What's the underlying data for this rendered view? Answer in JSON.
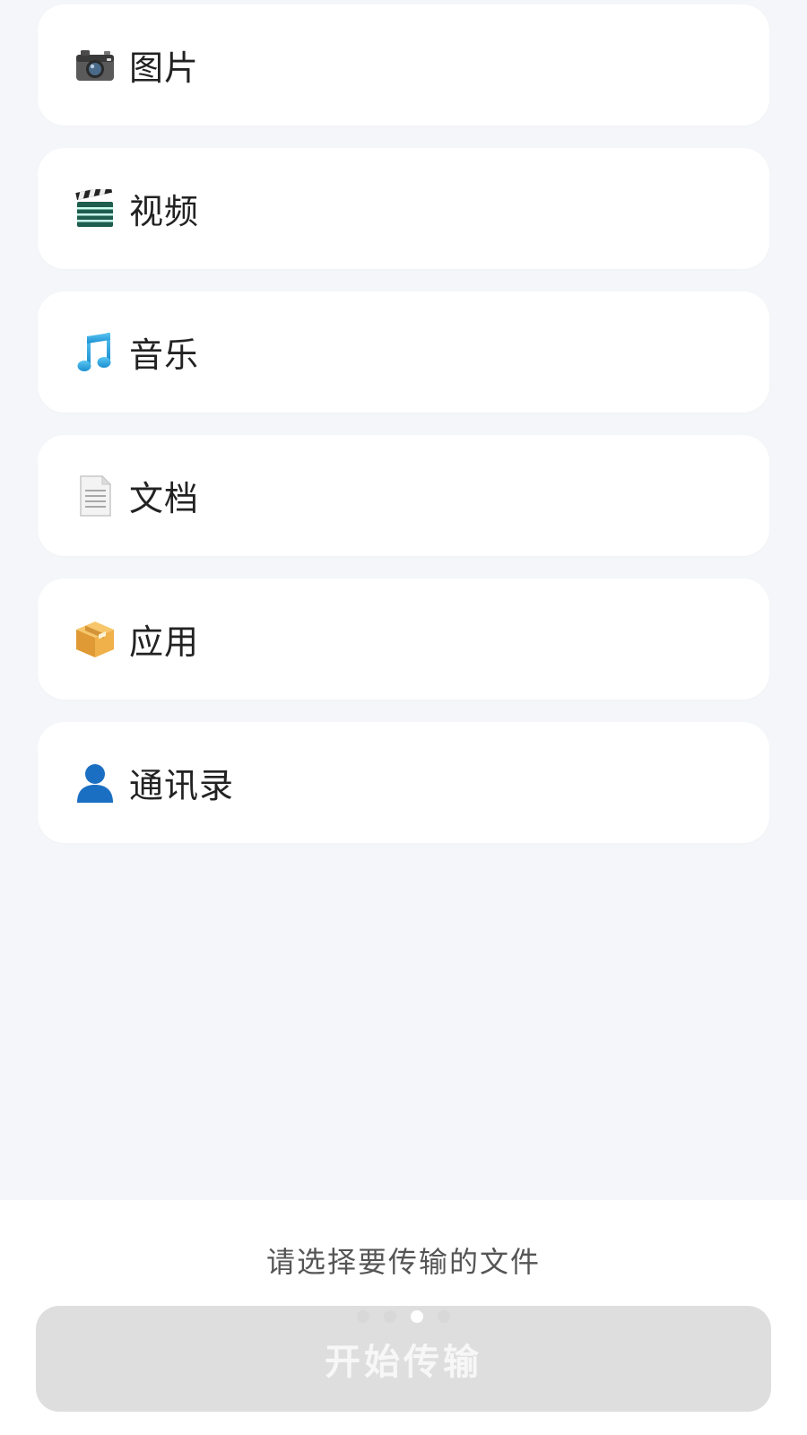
{
  "categories": [
    {
      "label": "图片",
      "icon": "camera-icon"
    },
    {
      "label": "视频",
      "icon": "clapperboard-icon"
    },
    {
      "label": "音乐",
      "icon": "music-note-icon"
    },
    {
      "label": "文档",
      "icon": "document-icon"
    },
    {
      "label": "应用",
      "icon": "package-icon"
    },
    {
      "label": "通讯录",
      "icon": "contact-icon"
    }
  ],
  "footer": {
    "hint": "请选择要传输的文件",
    "button_label": "开始传输",
    "page_indicator": {
      "count": 4,
      "active_index": 2
    }
  },
  "colors": {
    "background": "#f4f6f9",
    "card": "#ffffff",
    "button_disabled": "#dedede"
  }
}
